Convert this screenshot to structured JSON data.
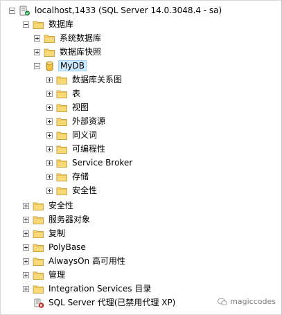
{
  "tree": {
    "server": "localhost,1433 (SQL Server 14.0.3048.4 - sa)",
    "databases": "数据库",
    "system_databases": "系统数据库",
    "database_snapshots": "数据库快照",
    "mydb": "MyDB",
    "mydb_children": [
      "数据库关系图",
      "表",
      "视图",
      "外部资源",
      "同义词",
      "可编程性",
      "Service Broker",
      "存储",
      "安全性"
    ],
    "top_level": [
      "安全性",
      "服务器对象",
      "复制",
      "PolyBase",
      "AlwaysOn 高可用性",
      "管理",
      "Integration Services 目录"
    ],
    "agent": "SQL Server 代理(已禁用代理 XP)"
  },
  "watermark": {
    "text": "magiccodes"
  },
  "colors": {
    "folder_fill": "#f7d97a",
    "folder_stroke": "#c9a33d",
    "selection": "#cce8ff",
    "database_icon": "#f0c24a"
  }
}
